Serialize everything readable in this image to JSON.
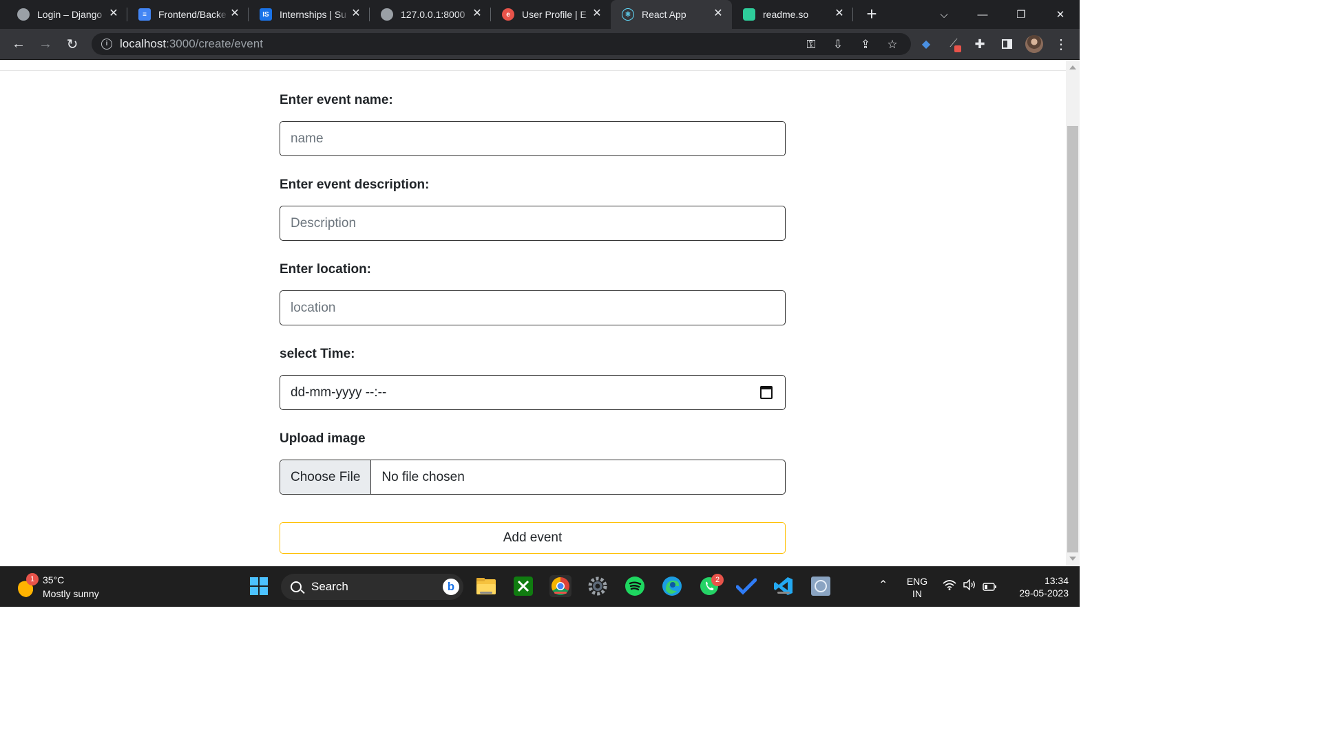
{
  "browser": {
    "tabs": [
      {
        "title": "Login – Django",
        "favicon": "globe-icon",
        "color": "#9aa0a6"
      },
      {
        "title": "Frontend/Backend",
        "favicon": "docs-icon",
        "color": "#4285f4"
      },
      {
        "title": "Internships | Su",
        "favicon": "is-icon",
        "color": "#1a73e8"
      },
      {
        "title": "127.0.0.1:8000",
        "favicon": "globe-icon",
        "color": "#9aa0a6"
      },
      {
        "title": "User Profile | E",
        "favicon": "e-icon",
        "color": "#e8534a"
      },
      {
        "title": "React App",
        "favicon": "react-icon",
        "color": "#61dafb",
        "active": true
      },
      {
        "title": "readme.so",
        "favicon": "readme-icon",
        "color": "#2ecc9a"
      }
    ],
    "url": {
      "host": "localhost",
      "path": ":3000/create/event"
    }
  },
  "form": {
    "name_label": "Enter event name:",
    "name_placeholder": "name",
    "description_label": "Enter event description:",
    "description_placeholder": "Description",
    "location_label": "Enter location:",
    "location_placeholder": "location",
    "time_label": "select Time:",
    "time_value": "dd-mm-yyyy --:--",
    "image_label": "Upload image",
    "choose_file": "Choose File",
    "no_file": "No file chosen",
    "submit": "Add event"
  },
  "taskbar": {
    "weather_temp": "35°C",
    "weather_desc": "Mostly sunny",
    "weather_badge": "1",
    "search_label": "Search",
    "whatsapp_badge": "2",
    "lang_line1": "ENG",
    "lang_line2": "IN",
    "time": "13:34",
    "date": "29-05-2023"
  }
}
